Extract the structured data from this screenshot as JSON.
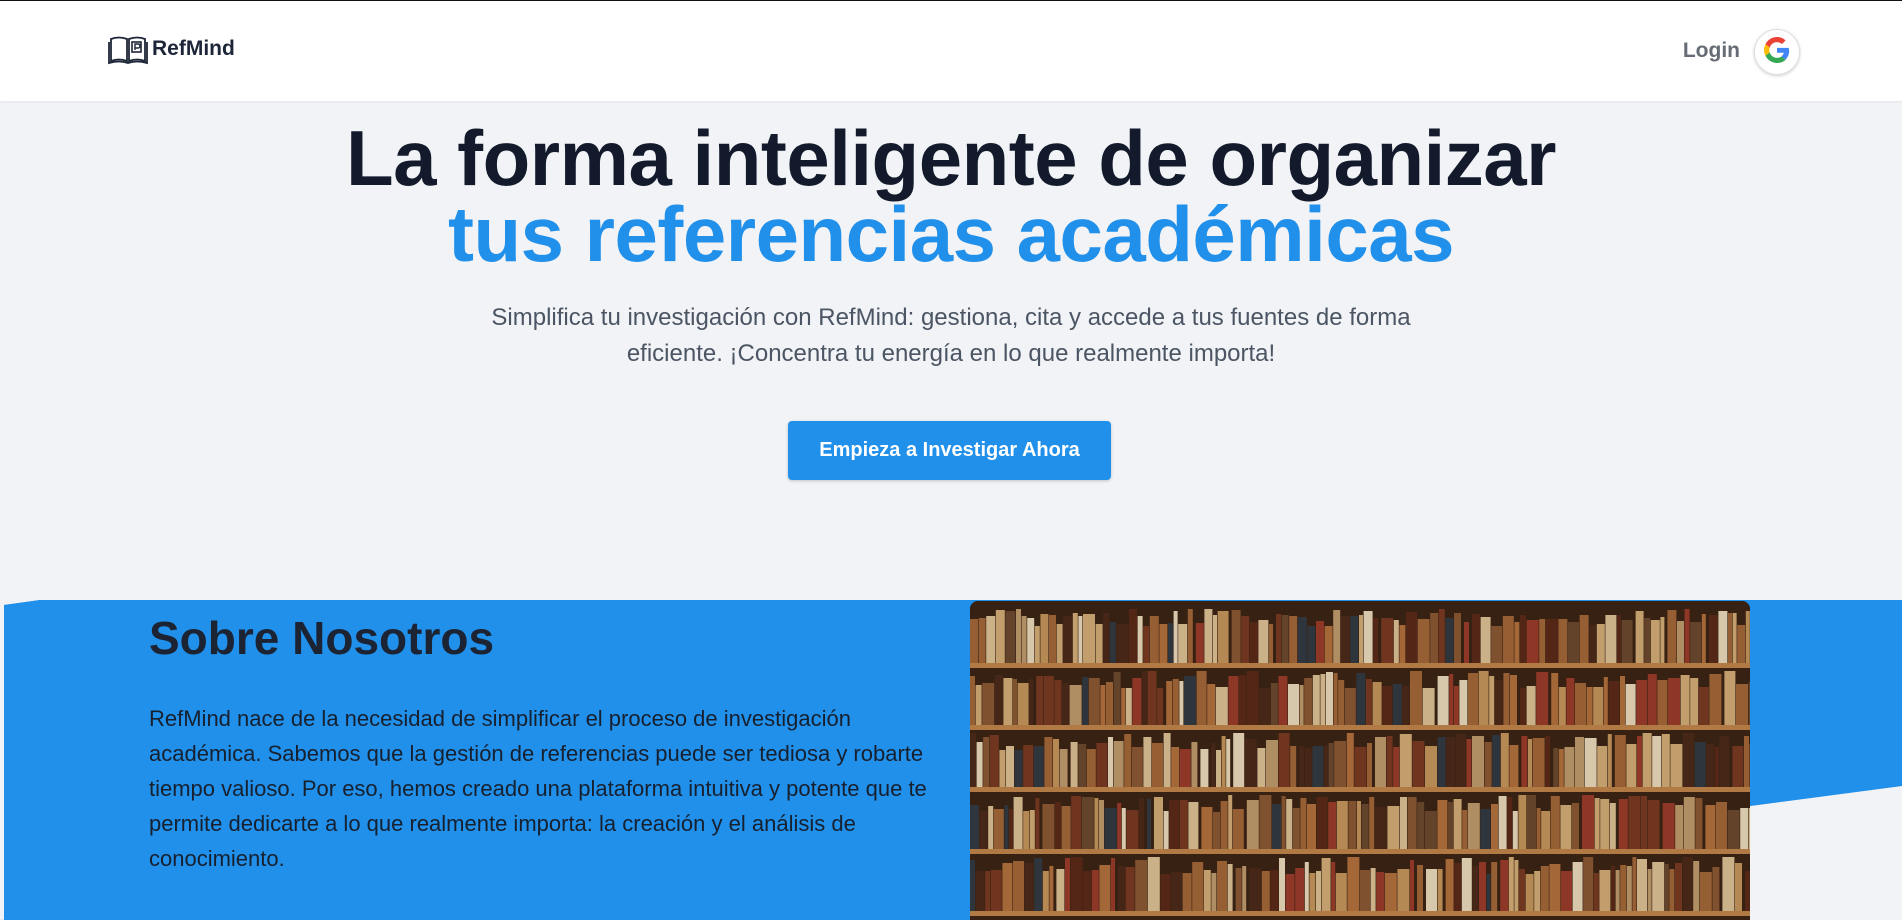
{
  "header": {
    "brand": "RefMind",
    "login_label": "Login"
  },
  "hero": {
    "title_line1": "La forma inteligente de organizar",
    "title_line2": "tus referencias académicas",
    "subtitle": "Simplifica tu investigación con RefMind: gestiona, cita y accede a tus fuentes de forma eficiente. ¡Concentra tu energía en lo que realmente importa!",
    "cta_label": "Empieza a Investigar Ahora"
  },
  "about": {
    "title": "Sobre Nosotros",
    "paragraph1": "RefMind nace de la necesidad de simplificar el proceso de investigación académica. Sabemos que la gestión de referencias puede ser tediosa y robarte tiempo valioso. Por eso, hemos creado una plataforma intuitiva y potente que te permite dedicarte a lo que realmente importa: la creación y el análisis de conocimiento.",
    "paragraph2": ""
  },
  "icons": {
    "logo": "open-book-icon",
    "google": "google-icon"
  },
  "colors": {
    "accent": "#2190ea",
    "title_dark": "#121a2b",
    "background": "#f1f3f6"
  }
}
